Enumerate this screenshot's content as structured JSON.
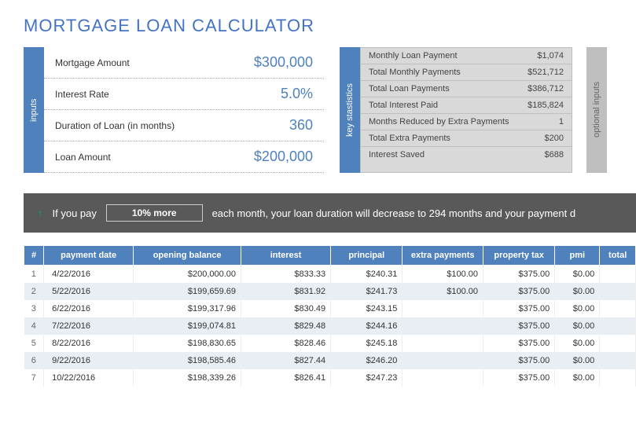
{
  "title": "MORTGAGE LOAN CALCULATOR",
  "inputs": {
    "sidebar": "inputs",
    "rows": [
      {
        "label": "Mortgage Amount",
        "value": "$300,000"
      },
      {
        "label": "Interest Rate",
        "value": "5.0%"
      },
      {
        "label": "Duration of Loan (in months)",
        "value": "360"
      },
      {
        "label": "Loan Amount",
        "value": "$200,000"
      }
    ]
  },
  "stats": {
    "sidebar": "key stastistics",
    "rows": [
      {
        "label": "Monthly Loan Payment",
        "value": "$1,074"
      },
      {
        "label": "Total Monthly Payments",
        "value": "$521,712"
      },
      {
        "label": "Total Loan Payments",
        "value": "$386,712"
      },
      {
        "label": "Total Interest Paid",
        "value": "$185,824"
      },
      {
        "label": "Months Reduced by Extra Payments",
        "value": "1"
      },
      {
        "label": "Total Extra Payments",
        "value": "$200"
      },
      {
        "label": "Interest Saved",
        "value": "$688"
      }
    ]
  },
  "optional": {
    "label": "optional inputs"
  },
  "banner": {
    "prefix": "If you pay",
    "pct": "10% more",
    "suffix": "each month, your loan duration will decrease to 294 months and your payment d"
  },
  "table": {
    "headers": [
      "#",
      "payment date",
      "opening balance",
      "interest",
      "principal",
      "extra payments",
      "property tax",
      "pmi",
      "total"
    ],
    "rows": [
      {
        "idx": "1",
        "date": "4/22/2016",
        "balance": "$200,000.00",
        "interest": "$833.33",
        "principal": "$240.31",
        "extra": "$100.00",
        "tax": "$375.00",
        "pmi": "$0.00"
      },
      {
        "idx": "2",
        "date": "5/22/2016",
        "balance": "$199,659.69",
        "interest": "$831.92",
        "principal": "$241.73",
        "extra": "$100.00",
        "tax": "$375.00",
        "pmi": "$0.00"
      },
      {
        "idx": "3",
        "date": "6/22/2016",
        "balance": "$199,317.96",
        "interest": "$830.49",
        "principal": "$243.15",
        "extra": "",
        "tax": "$375.00",
        "pmi": "$0.00"
      },
      {
        "idx": "4",
        "date": "7/22/2016",
        "balance": "$199,074.81",
        "interest": "$829.48",
        "principal": "$244.16",
        "extra": "",
        "tax": "$375.00",
        "pmi": "$0.00"
      },
      {
        "idx": "5",
        "date": "8/22/2016",
        "balance": "$198,830.65",
        "interest": "$828.46",
        "principal": "$245.18",
        "extra": "",
        "tax": "$375.00",
        "pmi": "$0.00"
      },
      {
        "idx": "6",
        "date": "9/22/2016",
        "balance": "$198,585.46",
        "interest": "$827.44",
        "principal": "$246.20",
        "extra": "",
        "tax": "$375.00",
        "pmi": "$0.00"
      },
      {
        "idx": "7",
        "date": "10/22/2016",
        "balance": "$198,339.26",
        "interest": "$826.41",
        "principal": "$247.23",
        "extra": "",
        "tax": "$375.00",
        "pmi": "$0.00"
      }
    ]
  }
}
